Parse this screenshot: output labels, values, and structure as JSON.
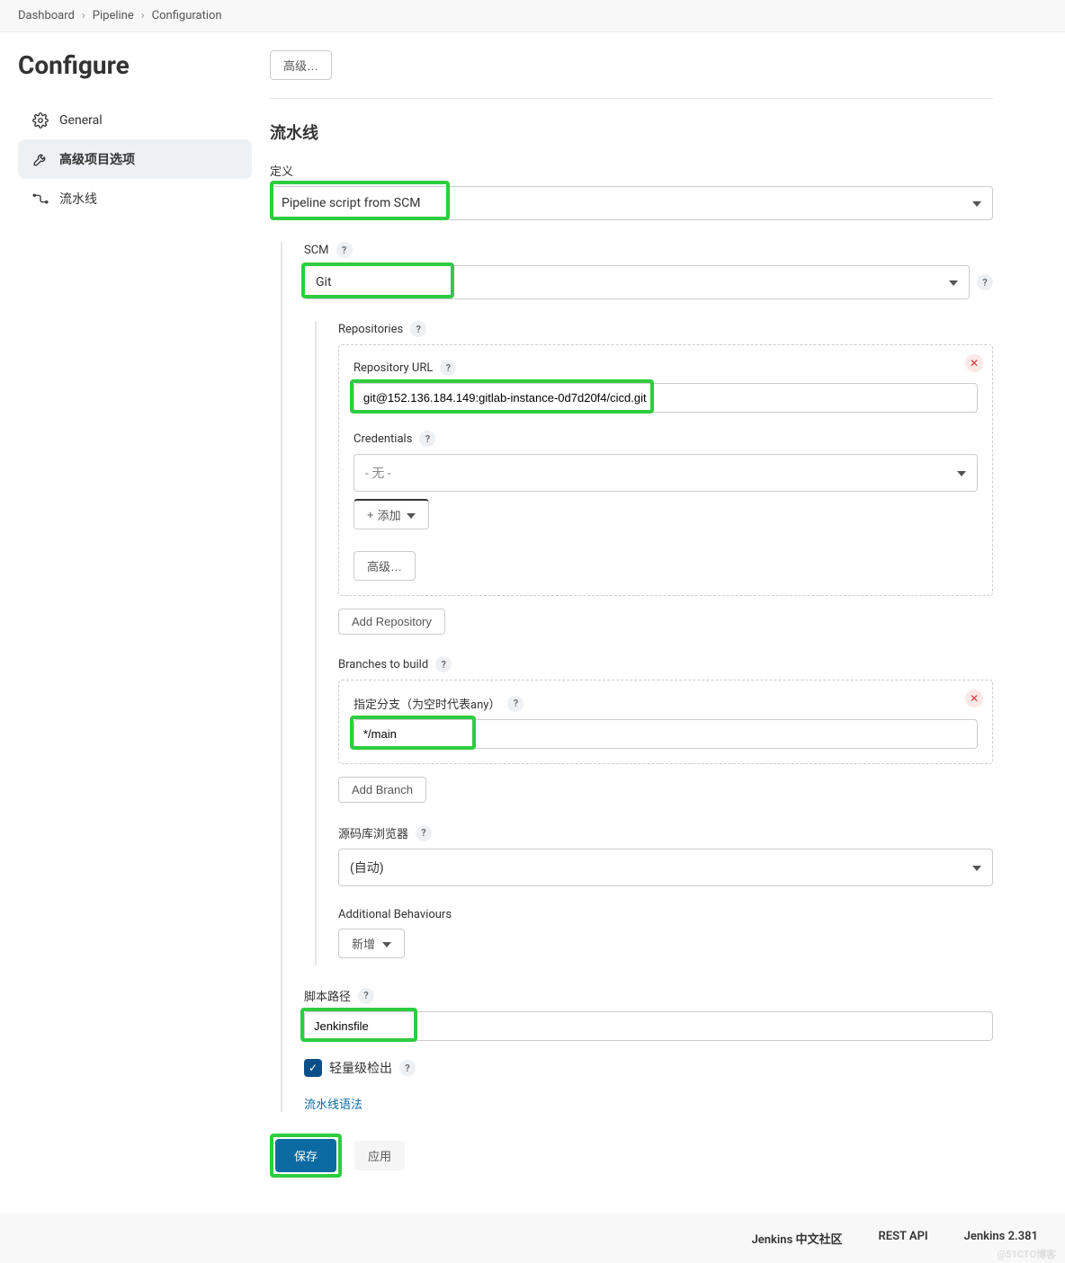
{
  "breadcrumb": {
    "items": [
      "Dashboard",
      "Pipeline",
      "Configuration"
    ]
  },
  "page": {
    "title": "Configure"
  },
  "sidebar": {
    "items": [
      {
        "label": "General"
      },
      {
        "label": "高级项目选项"
      },
      {
        "label": "流水线"
      }
    ]
  },
  "advanced_btn": "高级…",
  "pipeline": {
    "heading": "流水线",
    "definition_label": "定义",
    "definition_value": "Pipeline script from SCM",
    "scm_label": "SCM",
    "scm_value": "Git",
    "repos": {
      "label": "Repositories",
      "url_label": "Repository URL",
      "url_value": "git@152.136.184.149:gitlab-instance-0d7d20f4/cicd.git",
      "cred_label": "Credentials",
      "cred_value": "- 无 -",
      "add_cred": "添加",
      "adv": "高级…",
      "add_repo": "Add Repository"
    },
    "branches": {
      "label": "Branches to build",
      "spec_label": "指定分支（为空时代表any）",
      "value": "*/main",
      "add_branch": "Add Branch"
    },
    "browser": {
      "label": "源码库浏览器",
      "value": "(自动)"
    },
    "behaviours": {
      "label": "Additional Behaviours",
      "add": "新增"
    },
    "script_path": {
      "label": "脚本路径",
      "value": "Jenkinsfile"
    },
    "lightweight": "轻量级检出",
    "syntax_link": "流水线语法"
  },
  "actions": {
    "save": "保存",
    "apply": "应用"
  },
  "footer": {
    "community": "Jenkins 中文社区",
    "rest": "REST API",
    "version": "Jenkins 2.381"
  },
  "watermark": "@51CTO博客"
}
